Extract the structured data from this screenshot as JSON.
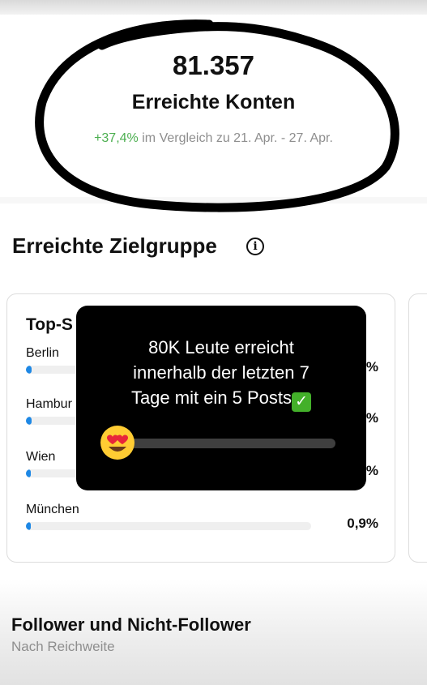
{
  "summary": {
    "value": "81.357",
    "label": "Erreichte Konten",
    "change": "+37,4%",
    "compare_text": "im Vergleich zu 21. Apr. - 27. Apr."
  },
  "audience": {
    "title": "Erreichte Zielgruppe",
    "card_title": "Top-S",
    "cities": [
      {
        "name": "Berlin",
        "percent": "%",
        "share": 0.02
      },
      {
        "name": "Hambur",
        "percent": "%",
        "share": 0.02
      },
      {
        "name": "Wien",
        "percent": "%",
        "share": 0.01
      },
      {
        "name": "München",
        "percent": "0,9%",
        "share": 0.009
      }
    ]
  },
  "overlay": {
    "text": "80K Leute erreicht\ninnerhalb der letzten 7\nTage mit ein 5 Posts",
    "emoji": "heart-eyes-emoji",
    "check_icon": "check-mark-emoji"
  },
  "followers": {
    "title": "Follower und Nicht-Follower",
    "subtitle": "Nach Reichweite"
  },
  "colors": {
    "positive": "#4caf50",
    "bar": "#1e88e5",
    "muted": "#8e8e8e"
  }
}
